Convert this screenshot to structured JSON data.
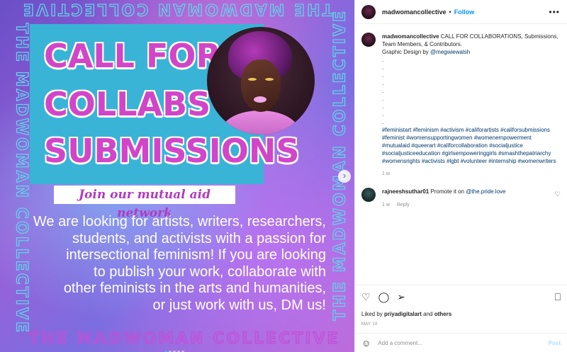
{
  "post": {
    "frame_text": "THE MADWOMAN COLLECTIVE",
    "title_lines": [
      "CALL FOR",
      "COLLABS &",
      "SUBMISSIONS"
    ],
    "subtitle": "Join our mutual aid network",
    "body_lines": [
      "We are looking for artists, writers, researchers,",
      "students, and activists with a passion for",
      "intersectional feminism! If you are looking",
      "to publish your work, collaborate with",
      "other feminists in the arts and humanities,",
      "or just work with us, DM us!"
    ],
    "next_icon": "chevron-right-icon",
    "carousel_total": 5,
    "carousel_current": 1
  },
  "header": {
    "username": "madwomancollective",
    "separator": "•",
    "follow_label": "Follow",
    "more_icon": "•••"
  },
  "caption": {
    "username": "madwomancollective",
    "text": "CALL FOR COLLABORATIONS, Submissions, Team Members, & Contributors.",
    "credit_prefix": "Graphic Design by ",
    "credit_mention": "@megwiewalsh",
    "dots": [
      ".",
      ".",
      ".",
      ".",
      ".",
      ".",
      ".",
      ".",
      "."
    ],
    "hashtags": "#feministart #feminism #activism #califorartists #califorsubmissions #feminist #womensupportingwomen #womenempowerment #mutualaid #queerart #califorcollaboration #socialjustice #socialjusticeeducation #girlsempoweringgirls #smashthepatriarchy #womensrights #activists #lgbt #volunteer #internship #womenwriters",
    "time": "1 w"
  },
  "comment": {
    "username": "rajneeshsuthar01",
    "text": "Promote it on ",
    "mention": "@the.pride.love",
    "time": "1 w",
    "reply_label": "Reply",
    "like_icon": "♡"
  },
  "actions": {
    "like_icon": "♡",
    "comment_icon": "◯",
    "share_icon": "➢",
    "save_icon": "⎕",
    "liked_by_prefix": "Liked by ",
    "liked_by_user": "priyadigitalart",
    "liked_by_suffix": " and ",
    "liked_by_others": "others",
    "date": "MAY 10"
  },
  "add_comment": {
    "emoji_icon": "☺",
    "placeholder": "Add a comment...",
    "post_label": "Post"
  }
}
